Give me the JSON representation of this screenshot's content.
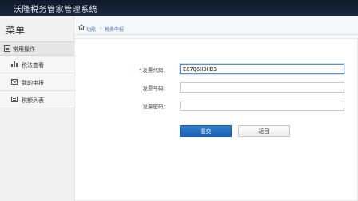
{
  "app": {
    "title": "沃隆税务管家管理系统"
  },
  "sidebar": {
    "title": "菜单",
    "group_label": "常用操作",
    "items": [
      {
        "label": "税法查看"
      },
      {
        "label": "我的申报"
      },
      {
        "label": "税额列表"
      }
    ]
  },
  "breadcrumb": {
    "items": [
      "功能",
      "税务申报"
    ],
    "separator": "›"
  },
  "form": {
    "code": {
      "label": "发票代码：",
      "value": "E87Q6H3HD3",
      "required": true
    },
    "number": {
      "label": "发票号码：",
      "value": ""
    },
    "password": {
      "label": "发票密码：",
      "value": ""
    },
    "submit_label": "提交",
    "back_label": "返回"
  },
  "colors": {
    "accent": "#1c5fae",
    "topbar": "#0f1a2b",
    "required": "#e02020"
  }
}
